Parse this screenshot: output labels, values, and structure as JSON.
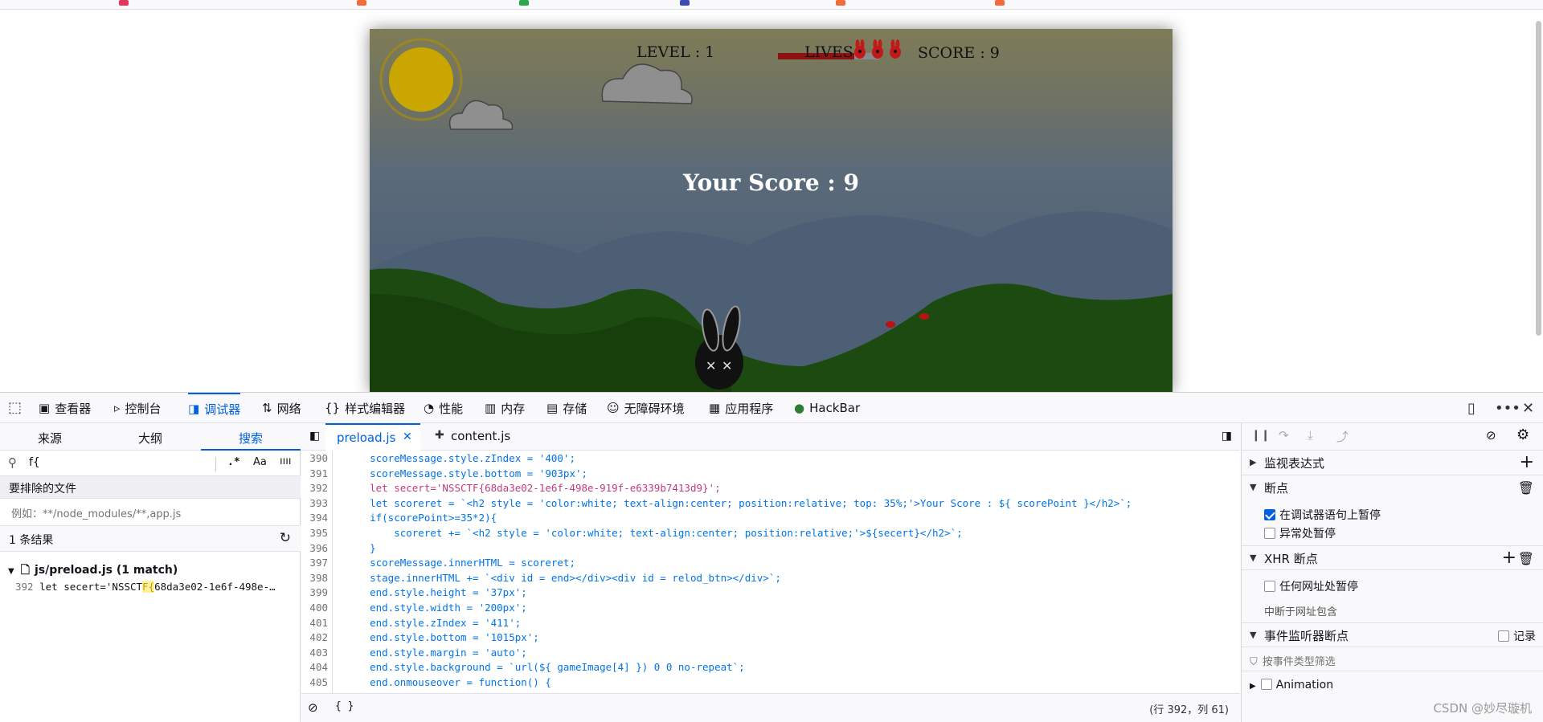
{
  "game": {
    "level_label": "LEVEL : 1",
    "level_progress": 0.75,
    "lives_label": "LIVES :",
    "lives_count": 3,
    "score_label": "SCORE : 9",
    "score_message": "Your Score : 9"
  },
  "devtools": {
    "tabs": [
      {
        "label": "查看器",
        "icon": "inspector-icon"
      },
      {
        "label": "控制台",
        "icon": "console-icon"
      },
      {
        "label": "调试器",
        "icon": "debugger-icon"
      },
      {
        "label": "网络",
        "icon": "network-icon"
      },
      {
        "label": "样式编辑器",
        "icon": "style-editor-icon"
      },
      {
        "label": "性能",
        "icon": "performance-icon"
      },
      {
        "label": "内存",
        "icon": "memory-icon"
      },
      {
        "label": "存储",
        "icon": "storage-icon"
      },
      {
        "label": "无障碍环境",
        "icon": "accessibility-icon"
      },
      {
        "label": "应用程序",
        "icon": "application-icon"
      },
      {
        "label": "HackBar",
        "icon": "hackbar-icon"
      }
    ],
    "left_panel": {
      "tabs": [
        "来源",
        "大纲",
        "搜索"
      ],
      "search_value": "f{",
      "search_toggles": [
        ".*",
        "Aa",
        "ıııı"
      ],
      "exclude_label": "要排除的文件",
      "exclude_placeholder": "例如：**/node_modules/**,app.js",
      "results_count": "1 条结果",
      "result_file": "js/preload.js (1 match)",
      "result_line_no": "392",
      "result_line_before": "let secert='NSSCT",
      "result_line_match": "F{",
      "result_line_after": "68da3e02-1e6f-498e-…"
    },
    "editor": {
      "tabs": [
        "preload.js",
        "content.js"
      ],
      "lines": [
        {
          "no": "390",
          "text": "    scoreMessage.style.zIndex = '400';"
        },
        {
          "no": "391",
          "text": "    scoreMessage.style.bottom = '903px';"
        },
        {
          "no": "392",
          "text": "    let secert='NSSCTF{68da3e02-1e6f-498e-919f-e6339b7413d9}';"
        },
        {
          "no": "393",
          "text": "    let scoreret = `<h2 style = 'color:white; text-align:center; position:relative; top: 35%;'>Your Score : ${ scorePoint }</h2>`;"
        },
        {
          "no": "394",
          "text": "    if(scorePoint>=35*2){"
        },
        {
          "no": "395",
          "text": "        scoreret += `<h2 style = 'color:white; text-align:center; position:relative;'>${secert}</h2>`;"
        },
        {
          "no": "396",
          "text": "    }"
        },
        {
          "no": "397",
          "text": "    scoreMessage.innerHTML = scoreret;"
        },
        {
          "no": "398",
          "text": "    stage.innerHTML += `<div id = end></div><div id = relod_btn></div>`;"
        },
        {
          "no": "399",
          "text": "    end.style.height = '37px';"
        },
        {
          "no": "400",
          "text": "    end.style.width = '200px';"
        },
        {
          "no": "401",
          "text": "    end.style.zIndex = '411';"
        },
        {
          "no": "402",
          "text": "    end.style.bottom = '1015px';"
        },
        {
          "no": "403",
          "text": "    end.style.margin = 'auto';"
        },
        {
          "no": "404",
          "text": "    end.style.background = `url(${ gameImage[4] }) 0 0 no-repeat`;"
        },
        {
          "no": "405",
          "text": "    end.onmouseover = function() {"
        }
      ],
      "footer_braces": "{ }",
      "cursor_position": "(行 392，列 61)"
    },
    "right_panel": {
      "watch_label": "监视表达式",
      "breakpoints_label": "断点",
      "pause_on_debugger": "在调试器语句上暂停",
      "pause_on_exceptions": "异常处暂停",
      "xhr_label": "XHR 断点",
      "any_url": "任何网址处暂停",
      "url_contains": "中断于网址包含",
      "event_label": "事件监听器断点",
      "record_label": "记录",
      "event_filter_placeholder": "按事件类型筛选",
      "animation_label": "Animation"
    }
  },
  "watermark": "CSDN @妙尽璇机"
}
